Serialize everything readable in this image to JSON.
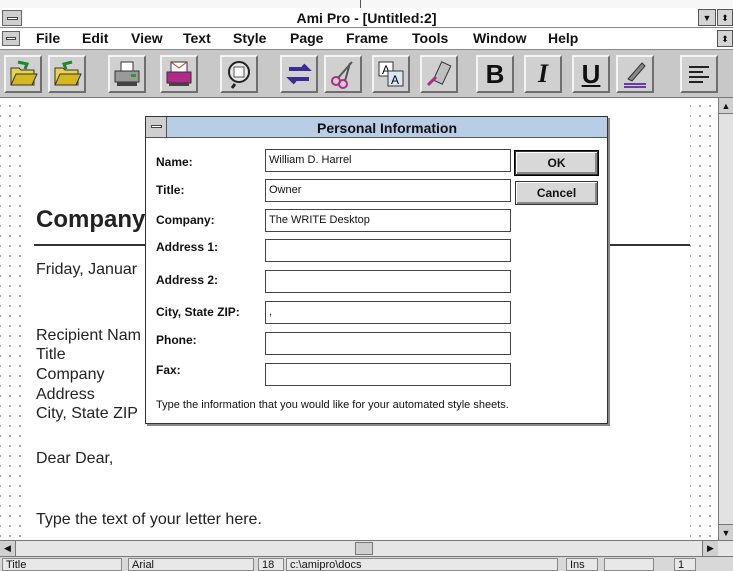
{
  "window": {
    "title": "Ami Pro - [Untitled:2]"
  },
  "menu": [
    {
      "label": "File"
    },
    {
      "label": "Edit"
    },
    {
      "label": "View"
    },
    {
      "label": "Text"
    },
    {
      "label": "Style"
    },
    {
      "label": "Page"
    },
    {
      "label": "Frame"
    },
    {
      "label": "Tools"
    },
    {
      "label": "Window"
    },
    {
      "label": "Help"
    }
  ],
  "toolbar": {
    "icons": [
      "open-file-icon",
      "save-file-icon",
      "print-icon",
      "print-envelope-icon",
      "zoom-icon",
      "replace-arrows-icon",
      "scissors-icon",
      "copy-text-icon",
      "paste-glue-icon",
      "bold-icon",
      "italic-icon",
      "underline-icon",
      "fast-format-icon",
      "align-left-icon"
    ],
    "bold_label": "B",
    "italic_label": "I",
    "underline_label": "U"
  },
  "document": {
    "heading": "Company",
    "date": "Friday, Januar",
    "recipient": [
      "Recipient Nam",
      "Title",
      "Company",
      "Address",
      "City, State ZIP"
    ],
    "salutation": "Dear Dear,",
    "body": "Type the text of your letter here."
  },
  "dialog": {
    "title": "Personal Information",
    "fields": [
      {
        "label": "Name:",
        "value": "William D. Harrel"
      },
      {
        "label": "Title:",
        "value": "Owner"
      },
      {
        "label": "Company:",
        "value": "The WRITE Desktop"
      },
      {
        "label": "Address 1:",
        "value": ""
      },
      {
        "label": "Address 2:",
        "value": ""
      },
      {
        "label": "City, State ZIP:",
        "value": ","
      },
      {
        "label": "Phone:",
        "value": ""
      },
      {
        "label": "Fax:",
        "value": ""
      }
    ],
    "ok_label": "OK",
    "cancel_label": "Cancel",
    "help_text": "Type the information that you would like for your automated style sheets."
  },
  "statusbar": {
    "style": "Title",
    "font": "Arial",
    "size": "18",
    "path": "c:\\amipro\\docs",
    "mode": "Ins",
    "page": "1"
  },
  "colors": {
    "dialog_title_bg": "#b8cde6",
    "toolbar_bg": "#c8c8c8",
    "grid_dots": "#9aa3b8"
  }
}
